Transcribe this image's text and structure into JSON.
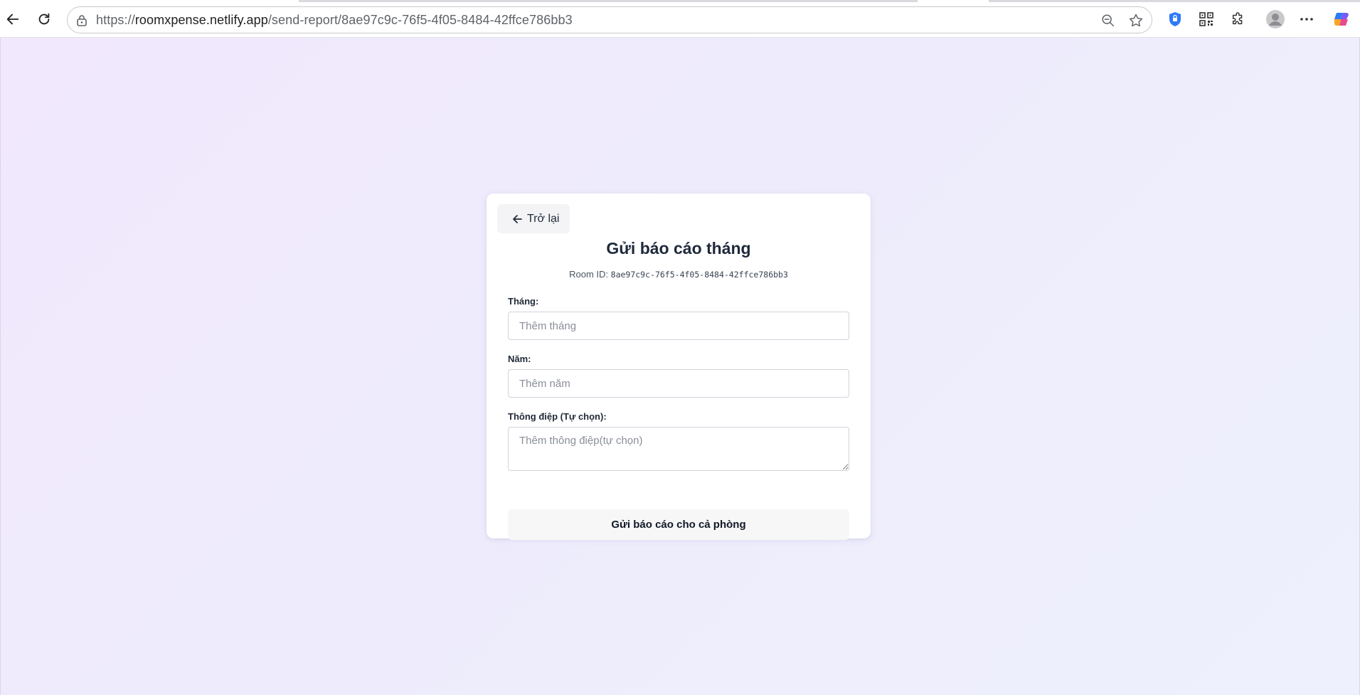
{
  "browser": {
    "url_scheme": "https://",
    "url_host": "roomxpense.netlify.app",
    "url_path": "/send-report/8ae97c9c-76f5-4f05-8484-42ffce786bb3",
    "icons": [
      "back-arrow-icon",
      "reload-icon",
      "lock-icon",
      "zoom-out-icon",
      "star-icon",
      "shield-icon",
      "qr-code-icon",
      "extensions-icon",
      "profile-icon",
      "more-icon",
      "copilot-icon"
    ]
  },
  "card": {
    "back_label": "Trở lại",
    "title": "Gửi báo cáo tháng",
    "room_label": "Room ID:",
    "room_id": "8ae97c9c-76f5-4f05-8484-42ffce786bb3",
    "month": {
      "label": "Tháng:",
      "value": "",
      "placeholder": "Thêm tháng"
    },
    "year": {
      "label": "Năm:",
      "value": "",
      "placeholder": "Thêm năm"
    },
    "message": {
      "label": "Thông điệp (Tự chọn):",
      "value": "",
      "placeholder": "Thêm thông điệp(tự chọn)"
    },
    "submit_label": "Gửi báo cáo cho cả phòng"
  },
  "colors": {
    "page_gradient_start": "#f1e8fd",
    "page_gradient_end": "#eef0fd",
    "title": "#1e293b"
  }
}
